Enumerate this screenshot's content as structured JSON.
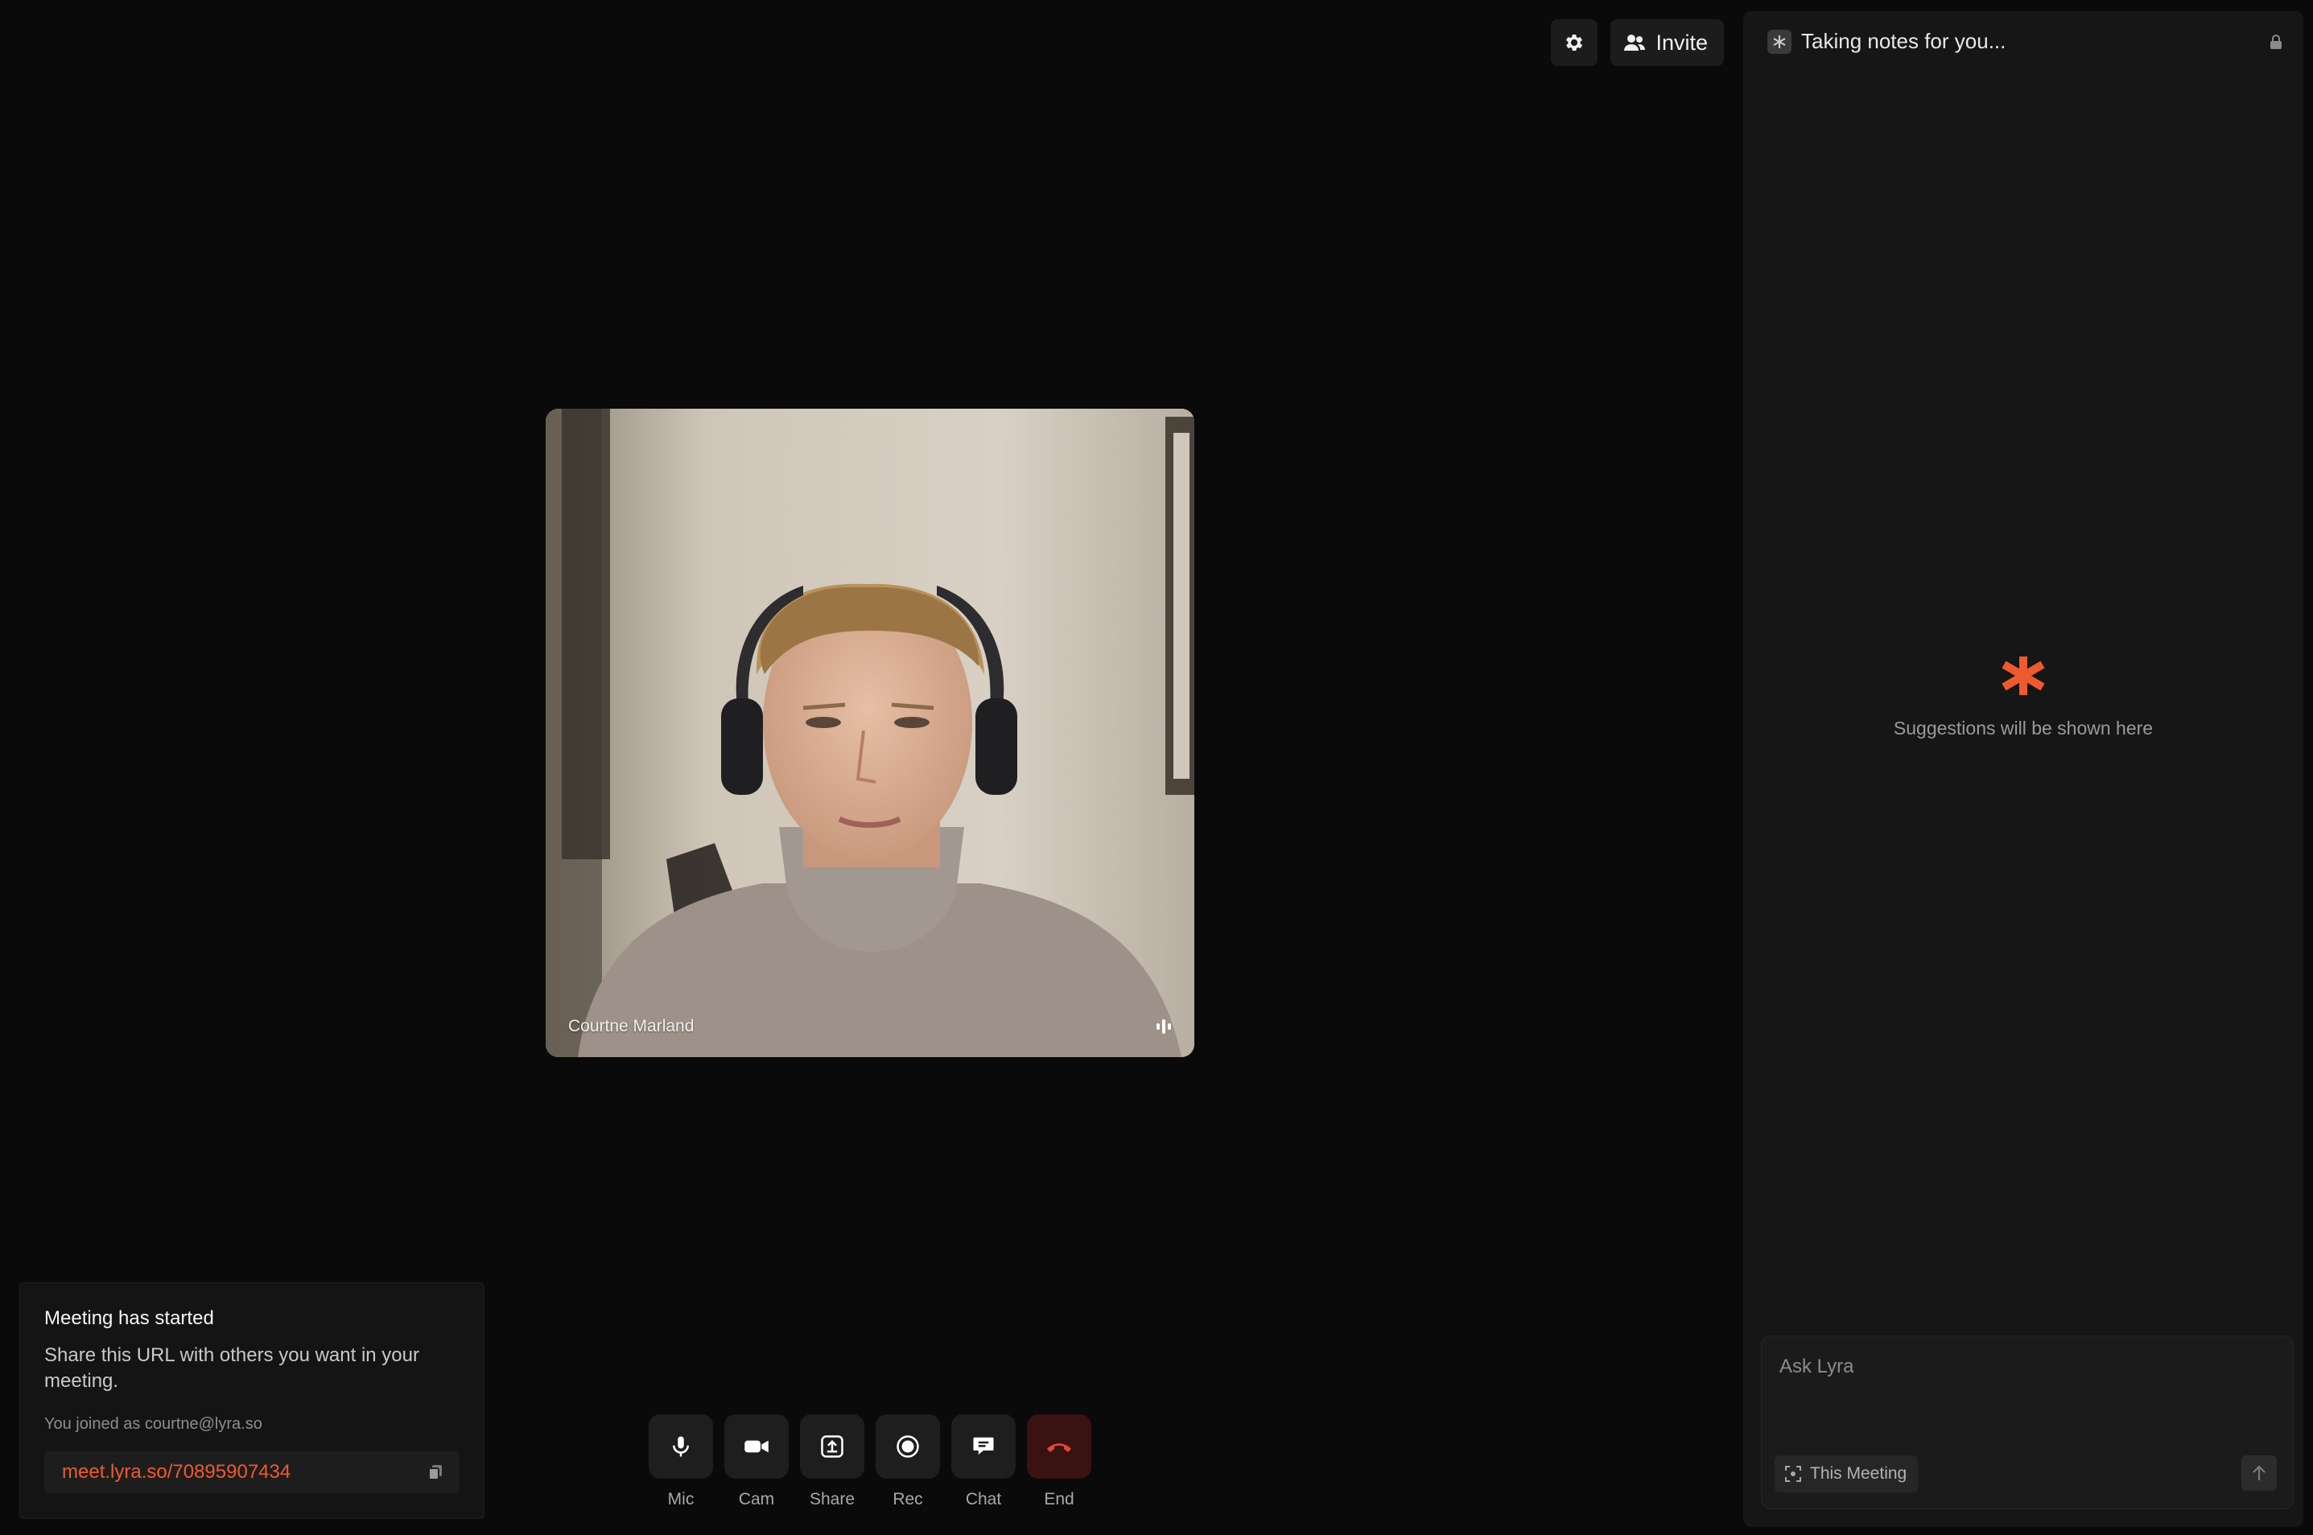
{
  "header": {
    "settings_icon": "gear-icon",
    "invite_label": "Invite",
    "invite_icon": "users-icon"
  },
  "video": {
    "participant_name": "Courtne Marland",
    "audio_icon": "audio-level-icon"
  },
  "toast": {
    "title": "Meeting has started",
    "body": "Share this URL with others you want in your meeting.",
    "joined": "You joined as courtne@lyra.so",
    "url": "meet.lyra.so/70895907434",
    "copy_icon": "copy-icon"
  },
  "controls": [
    {
      "label": "Mic",
      "icon": "microphone-icon"
    },
    {
      "label": "Cam",
      "icon": "camera-icon"
    },
    {
      "label": "Share",
      "icon": "share-screen-icon"
    },
    {
      "label": "Rec",
      "icon": "record-icon"
    },
    {
      "label": "Chat",
      "icon": "chat-icon"
    },
    {
      "label": "End",
      "icon": "hang-up-icon"
    }
  ],
  "panel": {
    "title": "Taking notes for you...",
    "empty_text": "Suggestions will be shown here",
    "ask_placeholder": "Ask Lyra",
    "scope_label": "This Meeting",
    "accent": "#ee5a2f"
  }
}
